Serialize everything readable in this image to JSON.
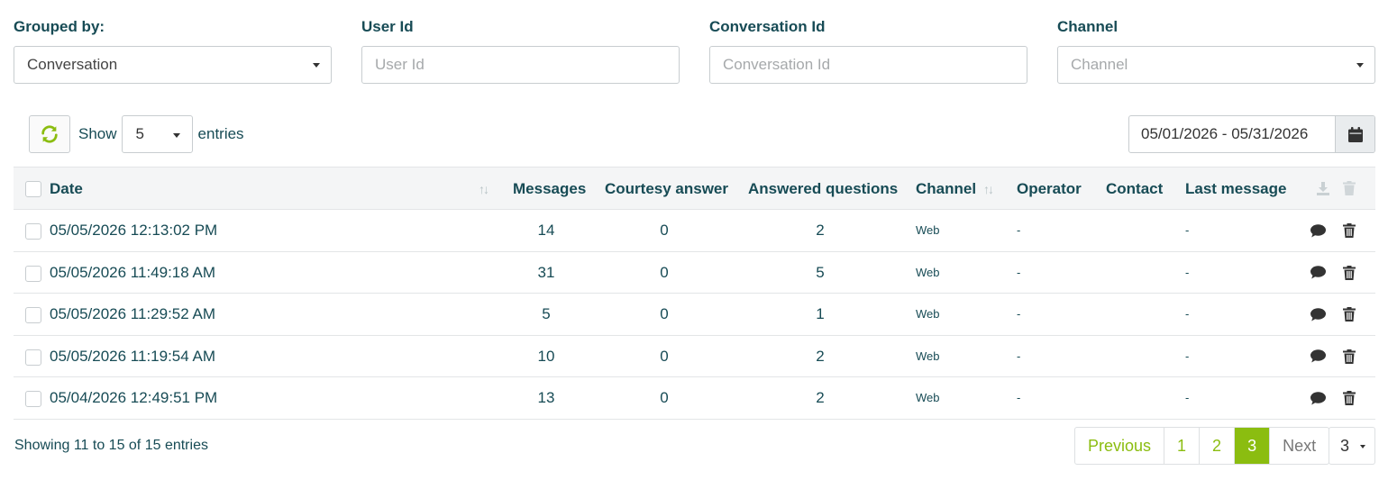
{
  "filters": {
    "grouped_by": {
      "label": "Grouped by:",
      "value": "Conversation"
    },
    "user_id": {
      "label": "User Id",
      "placeholder": "User Id"
    },
    "conversation_id": {
      "label": "Conversation Id",
      "placeholder": "Conversation Id"
    },
    "channel": {
      "label": "Channel",
      "placeholder": "Channel"
    }
  },
  "toolbar": {
    "refresh_icon": "refresh-icon",
    "show_label": "Show",
    "entries_value": "5",
    "entries_label": "entries",
    "date_range": "05/01/2026 - 05/31/2026",
    "calendar_icon": "calendar-icon"
  },
  "table": {
    "columns": {
      "date": "Date",
      "messages": "Messages",
      "courtesy": "Courtesy answer",
      "answered": "Answered questions",
      "channel": "Channel",
      "operator": "Operator",
      "contact": "Contact",
      "last_message": "Last message"
    },
    "sort_glyph": "↑↓",
    "rows": [
      {
        "date": "05/05/2026 12:13:02 PM",
        "messages": "14",
        "courtesy": "0",
        "answered": "2",
        "channel": "Web",
        "operator": "-",
        "last_message": "-"
      },
      {
        "date": "05/05/2026 11:49:18 AM",
        "messages": "31",
        "courtesy": "0",
        "answered": "5",
        "channel": "Web",
        "operator": "-",
        "last_message": "-"
      },
      {
        "date": "05/05/2026 11:29:52 AM",
        "messages": "5",
        "courtesy": "0",
        "answered": "1",
        "channel": "Web",
        "operator": "-",
        "last_message": "-"
      },
      {
        "date": "05/05/2026 11:19:54 AM",
        "messages": "10",
        "courtesy": "0",
        "answered": "2",
        "channel": "Web",
        "operator": "-",
        "last_message": "-"
      },
      {
        "date": "05/04/2026 12:49:51 PM",
        "messages": "13",
        "courtesy": "0",
        "answered": "2",
        "channel": "Web",
        "operator": "-",
        "last_message": "-"
      }
    ]
  },
  "footer": {
    "info": "Showing 11 to 15 of 15 entries",
    "previous": "Previous",
    "pages": [
      "1",
      "2",
      "3"
    ],
    "active_page": "3",
    "next": "Next",
    "page_select": "3"
  },
  "colors": {
    "accent": "#8bbd10",
    "text": "#174b55",
    "icon": "#333333"
  }
}
